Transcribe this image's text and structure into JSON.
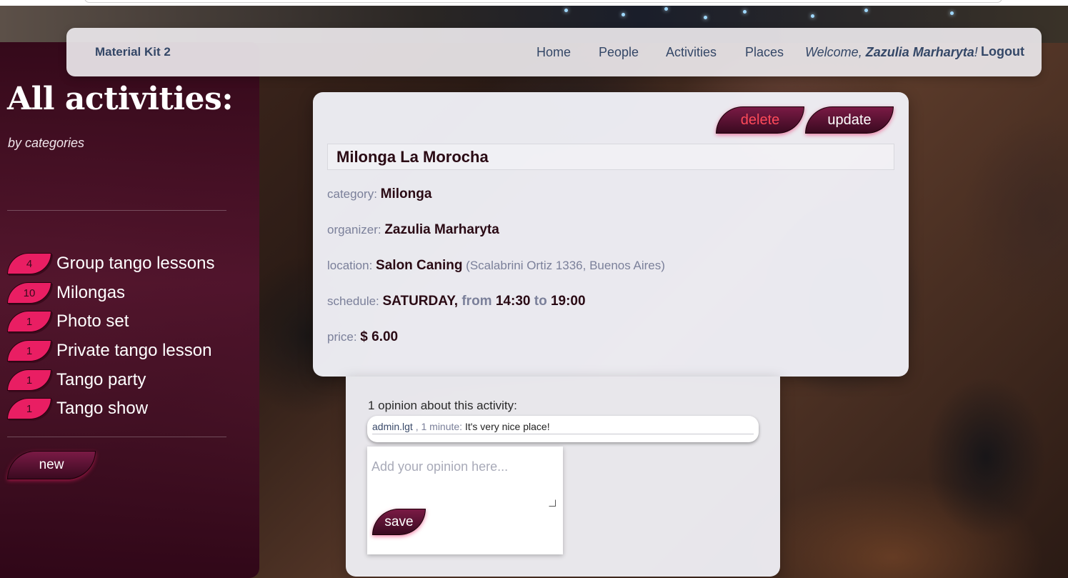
{
  "navbar": {
    "brand": "Material Kit 2",
    "links": [
      "Home",
      "People",
      "Activities",
      "Places"
    ],
    "welcome_prefix": "Welcome, ",
    "user_name": "Zazulia Marharyta",
    "welcome_suffix": "!",
    "logout": "Logout"
  },
  "sidebar": {
    "title": "All activities:",
    "subtitle": "by categories",
    "categories": [
      {
        "count": "4",
        "label": "Group tango lessons"
      },
      {
        "count": "10",
        "label": "Milongas"
      },
      {
        "count": "1",
        "label": "Photo set"
      },
      {
        "count": "1",
        "label": "Private tango lesson"
      },
      {
        "count": "1",
        "label": "Tango party"
      },
      {
        "count": "1",
        "label": "Tango show"
      }
    ],
    "new_button": "new"
  },
  "activity": {
    "delete_label": "delete",
    "update_label": "update",
    "title": "Milonga La Morocha",
    "category_label": "category: ",
    "category": "Milonga",
    "organizer_label": "organizer: ",
    "organizer": "Zazulia Marharyta",
    "location_label": "location: ",
    "location_name": "Salon Caning",
    "location_address": " (Scalabrini Ortiz 1336, Buenos Aires)",
    "schedule_label": "schedule: ",
    "schedule_day": "SATURDAY,",
    "from_word": " from ",
    "time_from": "14:30",
    "to_word": " to ",
    "time_to": "19:00",
    "price_label": "price: ",
    "price": "$ 6.00"
  },
  "opinions": {
    "heading": "1 opinion about this activity:",
    "items": [
      {
        "author": "admin.lgt",
        "time": " , 1 minute: ",
        "text": "It's very nice place!"
      }
    ],
    "placeholder": "Add your opinion here...",
    "save_label": "save"
  },
  "colors": {
    "accent": "#e91e63",
    "button_dark": "#3a0a20",
    "nav_text": "#344767",
    "delete_text": "#ff4a5a"
  }
}
